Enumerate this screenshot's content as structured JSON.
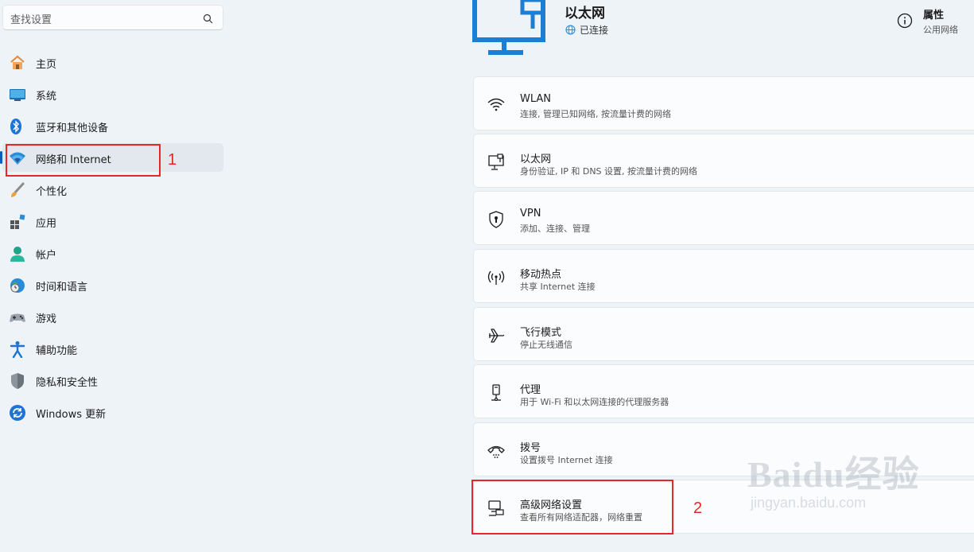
{
  "sidebar": {
    "search_placeholder": "查找设置",
    "items": [
      {
        "label": "主页",
        "icon": "home-icon"
      },
      {
        "label": "系统",
        "icon": "system-icon"
      },
      {
        "label": "蓝牙和其他设备",
        "icon": "bluetooth-icon"
      },
      {
        "label": "网络和 Internet",
        "icon": "wifi-icon"
      },
      {
        "label": "个性化",
        "icon": "brush-icon"
      },
      {
        "label": "应用",
        "icon": "apps-icon"
      },
      {
        "label": "帐户",
        "icon": "account-icon"
      },
      {
        "label": "时间和语言",
        "icon": "time-language-icon"
      },
      {
        "label": "游戏",
        "icon": "gaming-icon"
      },
      {
        "label": "辅助功能",
        "icon": "accessibility-icon"
      },
      {
        "label": "隐私和安全性",
        "icon": "shield-icon"
      },
      {
        "label": "Windows 更新",
        "icon": "update-icon"
      }
    ]
  },
  "annotations": {
    "marker1": "1",
    "marker2": "2"
  },
  "hero": {
    "title": "以太网",
    "status": "已连接"
  },
  "properties": {
    "title": "属性",
    "subtitle": "公用网络"
  },
  "cards": [
    {
      "title": "WLAN",
      "subtitle": "连接, 管理已知网络, 按流量计费的网络",
      "icon": "wlan-icon"
    },
    {
      "title": "以太网",
      "subtitle": "身份验证, IP 和 DNS 设置, 按流量计费的网络",
      "icon": "ethernet-icon"
    },
    {
      "title": "VPN",
      "subtitle": "添加、连接、管理",
      "icon": "vpn-shield-icon"
    },
    {
      "title": "移动热点",
      "subtitle": "共享 Internet 连接",
      "icon": "hotspot-icon"
    },
    {
      "title": "飞行模式",
      "subtitle": "停止无线通信",
      "icon": "airplane-icon"
    },
    {
      "title": "代理",
      "subtitle": "用于 Wi-Fi 和以太网连接的代理服务器",
      "icon": "proxy-icon"
    },
    {
      "title": "拨号",
      "subtitle": "设置拨号 Internet 连接",
      "icon": "dialup-icon"
    },
    {
      "title": "高级网络设置",
      "subtitle": "查看所有网络适配器，网络重置",
      "icon": "advanced-network-icon"
    }
  ],
  "watermark": {
    "logo": "Baidu经验",
    "url": "jingyan.baidu.com"
  },
  "colors": {
    "accent": "#005fb8",
    "annotation": "#e8262a",
    "background": "#eef3f8"
  }
}
